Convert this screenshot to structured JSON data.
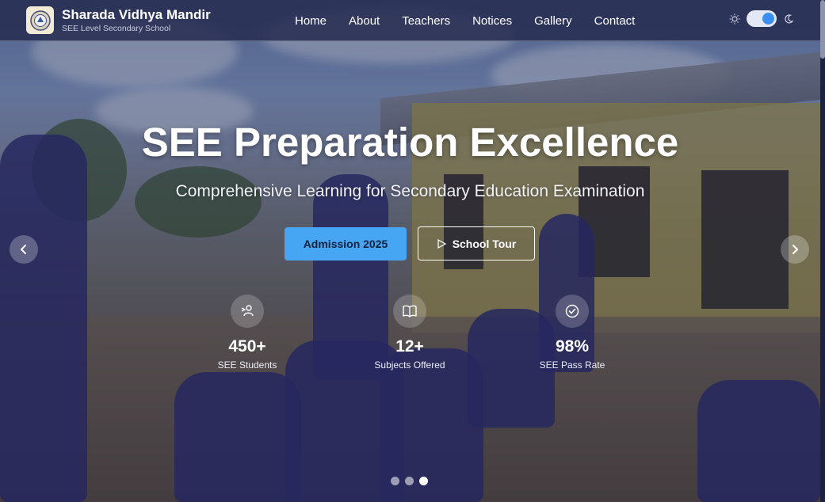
{
  "brand": {
    "name": "Sharada Vidhya Mandir",
    "subtitle": "SEE Level Secondary School",
    "logo_icon": "school-emblem-icon"
  },
  "nav": {
    "items": [
      "Home",
      "About",
      "Teachers",
      "Notices",
      "Gallery",
      "Contact"
    ]
  },
  "theme_toggle": {
    "light_icon": "sun-icon",
    "dark_icon": "moon-icon",
    "state": "dark",
    "accent": "#3b8ff0"
  },
  "hero": {
    "title": "SEE Preparation Excellence",
    "subtitle": "Comprehensive Learning for Secondary Education Examination",
    "primary_button": "Admission 2025",
    "secondary_button": "School Tour",
    "primary_color": "#46a6f4"
  },
  "stats": [
    {
      "value": "450+",
      "label": "SEE Students",
      "icon": "graduate-icon"
    },
    {
      "value": "12+",
      "label": "Subjects Offered",
      "icon": "book-icon"
    },
    {
      "value": "98%",
      "label": "SEE Pass Rate",
      "icon": "check-badge-icon"
    }
  ],
  "carousel": {
    "slide_count": 3,
    "active_slide": 3
  }
}
